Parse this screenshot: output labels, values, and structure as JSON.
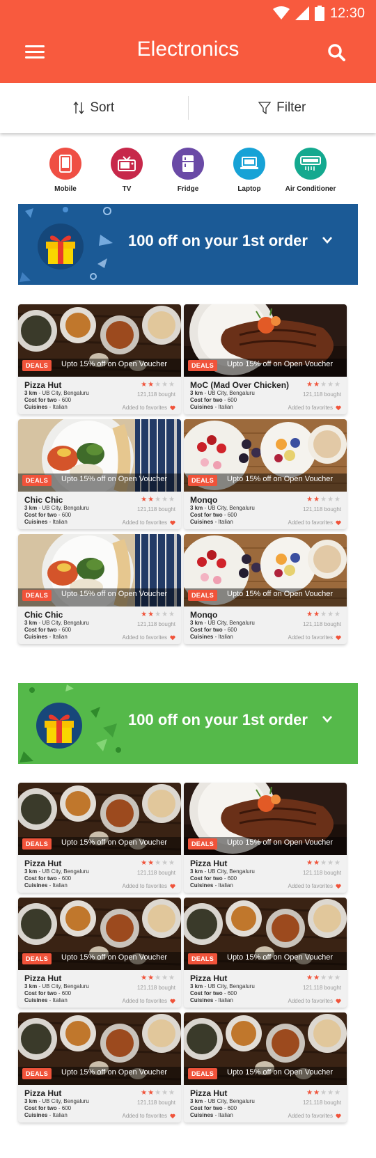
{
  "status_bar": {
    "time": "12:30"
  },
  "header": {
    "title": "Electronics"
  },
  "sort_filter": {
    "sort_label": "Sort",
    "filter_label": "Filter"
  },
  "categories": [
    {
      "label": "Mobile",
      "color": "#ef4f44",
      "icon": "mobile-icon"
    },
    {
      "label": "TV",
      "color": "#c7284a",
      "icon": "tv-icon"
    },
    {
      "label": "Fridge",
      "color": "#6a4aa6",
      "icon": "fridge-icon"
    },
    {
      "label": "Laptop",
      "color": "#17a2d6",
      "icon": "laptop-icon"
    },
    {
      "label": "Air Conditioner",
      "color": "#14a98f",
      "icon": "air-conditioner-icon"
    }
  ],
  "banners": [
    {
      "text": "100 off on your 1st order",
      "color": "#1b5a96",
      "icon": "gift-icon"
    },
    {
      "text": "100 off on your 1st order",
      "color": "#55b94a",
      "icon": "gift-icon"
    }
  ],
  "cards_group_1": [
    {
      "name": "Pizza Hut",
      "deal": "DEALS",
      "offer": "Upto 15% off on Open Voucher",
      "distance": "3 km",
      "location": " - UB City, Bengaluru",
      "cost_label": "Cost for two",
      "cost": " - 600",
      "cuisine_label": "Cuisines",
      "cuisine": " - Italian",
      "bought": "121,118 bought",
      "favorites": "Added to favorites",
      "rating": 2
    },
    {
      "name": "MoC (Mad Over Chicken)",
      "deal": "DEALS",
      "offer": "Upto 15% off on Open Voucher",
      "distance": "3 km",
      "location": " - UB City, Bengaluru",
      "cost_label": "Cost for two",
      "cost": " - 600",
      "cuisine_label": "Cuisines",
      "cuisine": " - Italian",
      "bought": "121,118 bought",
      "favorites": "Added to favorites",
      "rating": 2
    },
    {
      "name": "Chic Chic",
      "deal": "DEALS",
      "offer": "Upto 15% off on Open Voucher",
      "distance": "3 km",
      "location": " - UB City, Bengaluru",
      "cost_label": "Cost for two",
      "cost": " - 600",
      "cuisine_label": "Cuisines",
      "cuisine": " - Italian",
      "bought": "121,118 bought",
      "favorites": "Added to favorites",
      "rating": 2
    },
    {
      "name": "Monqo",
      "deal": "DEALS",
      "offer": "Upto 15% off on Open Voucher",
      "distance": "3 km",
      "location": " - UB City, Bengaluru",
      "cost_label": "Cost for two",
      "cost": " - 600",
      "cuisine_label": "Cuisines",
      "cuisine": " - Italian",
      "bought": "121,118 bought",
      "favorites": "Added to favorites",
      "rating": 2
    },
    {
      "name": "Chic Chic",
      "deal": "DEALS",
      "offer": "Upto 15% off on Open Voucher",
      "distance": "3 km",
      "location": " - UB City, Bengaluru",
      "cost_label": "Cost for two",
      "cost": " - 600",
      "cuisine_label": "Cuisines",
      "cuisine": " - Italian",
      "bought": "121,118 bought",
      "favorites": "Added to favorites",
      "rating": 2
    },
    {
      "name": "Monqo",
      "deal": "DEALS",
      "offer": "Upto 15% off on Open Voucher",
      "distance": "3 km",
      "location": " - UB City, Bengaluru",
      "cost_label": "Cost for two",
      "cost": " - 600",
      "cuisine_label": "Cuisines",
      "cuisine": " - Italian",
      "bought": "121,118 bought",
      "favorites": "Added to favorites",
      "rating": 2
    }
  ],
  "cards_group_2": [
    {
      "name": "Pizza Hut",
      "deal": "DEALS",
      "offer": "Upto 15% off on Open Voucher",
      "distance": "3 km",
      "location": " - UB City, Bengaluru",
      "cost_label": "Cost for two",
      "cost": " - 600",
      "cuisine_label": "Cuisines",
      "cuisine": " - Italian",
      "bought": "121,118 bought",
      "favorites": "Added to favorites",
      "rating": 2
    },
    {
      "name": "Pizza Hut",
      "deal": "DEALS",
      "offer": "Upto 15% off on Open Voucher",
      "distance": "3 km",
      "location": " - UB City, Bengaluru",
      "cost_label": "Cost for two",
      "cost": " - 600",
      "cuisine_label": "Cuisines",
      "cuisine": " - Italian",
      "bought": "121,118 bought",
      "favorites": "Added to favorites",
      "rating": 2
    },
    {
      "name": "Pizza Hut",
      "deal": "DEALS",
      "offer": "Upto 15% off on Open Voucher",
      "distance": "3 km",
      "location": " - UB City, Bengaluru",
      "cost_label": "Cost for two",
      "cost": " - 600",
      "cuisine_label": "Cuisines",
      "cuisine": " - Italian",
      "bought": "121,118 bought",
      "favorites": "Added to favorites",
      "rating": 2
    },
    {
      "name": "Pizza Hut",
      "deal": "DEALS",
      "offer": "Upto 15% off on Open Voucher",
      "distance": "3 km",
      "location": " - UB City, Bengaluru",
      "cost_label": "Cost for two",
      "cost": " - 600",
      "cuisine_label": "Cuisines",
      "cuisine": " - Italian",
      "bought": "121,118 bought",
      "favorites": "Added to favorites",
      "rating": 2
    },
    {
      "name": "Pizza Hut",
      "deal": "DEALS",
      "offer": "Upto 15% off on Open Voucher",
      "distance": "3 km",
      "location": " - UB City, Bengaluru",
      "cost_label": "Cost for two",
      "cost": " - 600",
      "cuisine_label": "Cuisines",
      "cuisine": " - Italian",
      "bought": "121,118 bought",
      "favorites": "Added to favorites",
      "rating": 2
    },
    {
      "name": "Pizza Hut",
      "deal": "DEALS",
      "offer": "Upto 15% off on Open Voucher",
      "distance": "3 km",
      "location": " - UB City, Bengaluru",
      "cost_label": "Cost for two",
      "cost": " - 600",
      "cuisine_label": "Cuisines",
      "cuisine": " - Italian",
      "bought": "121,118 bought",
      "favorites": "Added to favorites",
      "rating": 2
    }
  ],
  "colors": {
    "primary": "#f85a3e",
    "deal_badge": "#f0533a",
    "star_on": "#f0533a",
    "star_off": "#c9c9c9"
  }
}
